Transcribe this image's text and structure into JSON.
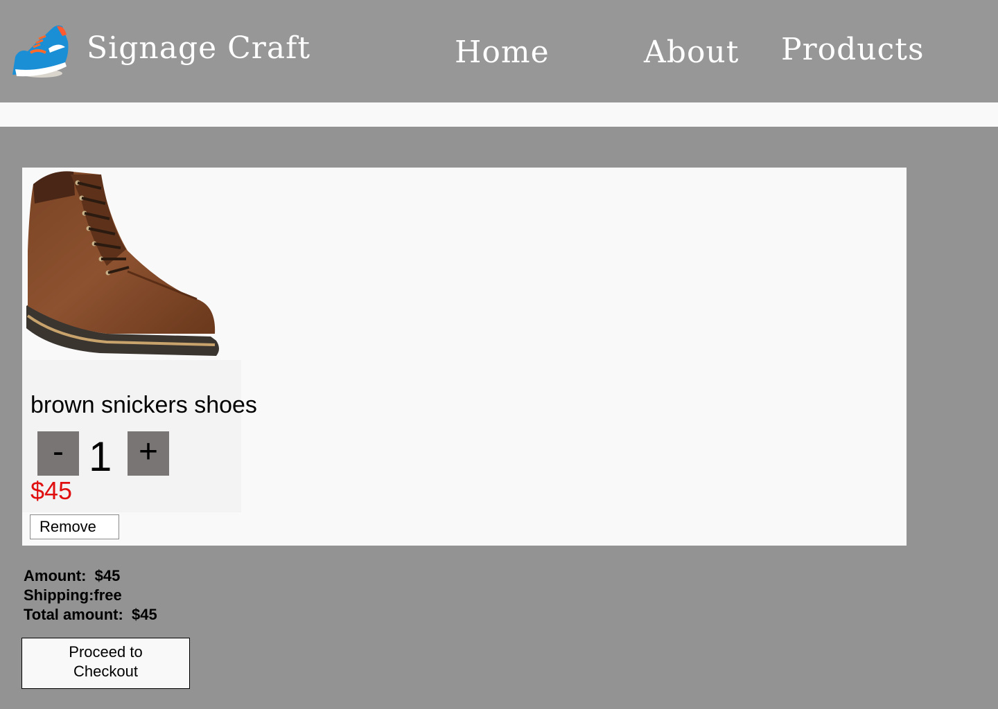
{
  "header": {
    "brand": "Signage Craft",
    "logo_icon": "sneaker-logo-icon",
    "nav": [
      {
        "label": "Home"
      },
      {
        "label": "About"
      },
      {
        "label": "Products"
      }
    ]
  },
  "cart": {
    "item": {
      "image_icon": "brown-boot-image",
      "name": "brown snickers shoes",
      "decrement_label": "-",
      "quantity": "1",
      "increment_label": "+",
      "price": "$45",
      "remove_label": "Remove"
    }
  },
  "summary": {
    "amount": "Amount:  $45",
    "shipping": "Shipping:free",
    "total": "Total amount:  $45"
  },
  "checkout": {
    "line1": "Proceed to",
    "line2": "Checkout"
  },
  "colors": {
    "background": "#939393",
    "header": "#979797",
    "card": "#f9f9f9",
    "price": "#e01010",
    "qty_button": "#7a7575"
  }
}
